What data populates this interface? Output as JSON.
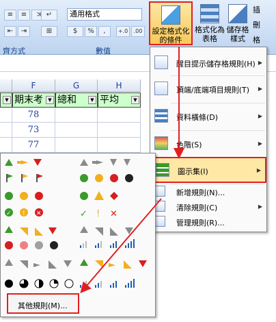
{
  "ribbon": {
    "number_format": "通用格式",
    "group_alignment_label": "齊方式",
    "group_number_label": "數值",
    "number_buttons": [
      "$",
      "%",
      ",",
      "+.0",
      ".00"
    ],
    "cf_button_label_1": "設定格式化",
    "cf_button_label_2": "的條件",
    "format_table_label_1": "格式化為",
    "format_table_label_2": "表格",
    "cell_style_label_1": "儲存格",
    "cell_style_label_2": "樣式",
    "right_partial_1": "插",
    "right_partial_2": "刪",
    "right_partial_3": "格"
  },
  "sheet": {
    "columns": [
      "F",
      "G",
      "H"
    ],
    "headers": [
      "期末考",
      "總和",
      "平均"
    ],
    "values": [
      "78",
      "73",
      "77"
    ]
  },
  "menu": {
    "items": [
      {
        "label": "醒目提示儲存格規則(H)"
      },
      {
        "label": "頂端/底端項目規則(T)"
      },
      {
        "label": "資料橫條(D)"
      },
      {
        "label": "色階(S)"
      },
      {
        "label": "圖示集(I)"
      },
      {
        "label": "新增規則(N)..."
      },
      {
        "label": "清除規則(C)"
      },
      {
        "label": "管理規則(R)..."
      }
    ]
  },
  "submenu": {
    "more_rules_label": "其他規則(M)..."
  },
  "colors": {
    "highlight_border": "#e02020",
    "green": "#3a9a2a",
    "yellow": "#f2b01e",
    "red": "#d81e1e",
    "gray": "#8a8a8a"
  }
}
